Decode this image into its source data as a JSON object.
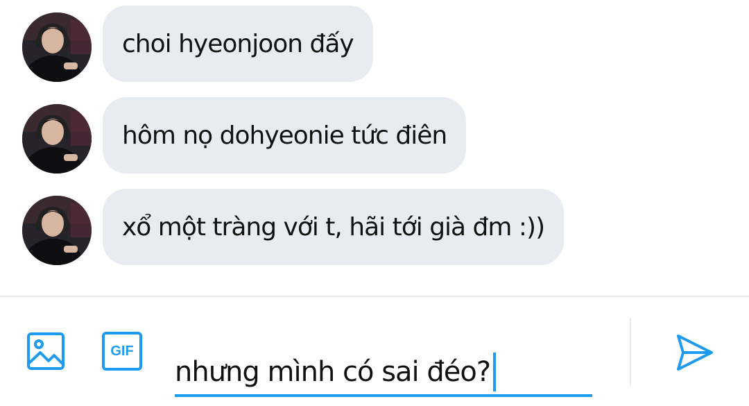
{
  "messages": [
    {
      "text": "choi hyeonjoon đấy"
    },
    {
      "text": "hôm nọ dohyeonie tức điên"
    },
    {
      "text": "xổ một tràng với t, hãi tới già đm :))"
    }
  ],
  "composer": {
    "input_value": "nhưng mình có sai đéo?",
    "gif_label": "GIF",
    "media_icon": "image-icon",
    "send_icon": "send-icon"
  },
  "colors": {
    "accent": "#1d9bf0",
    "bubble": "#e8ecf0",
    "divider": "#e6e9ec"
  }
}
